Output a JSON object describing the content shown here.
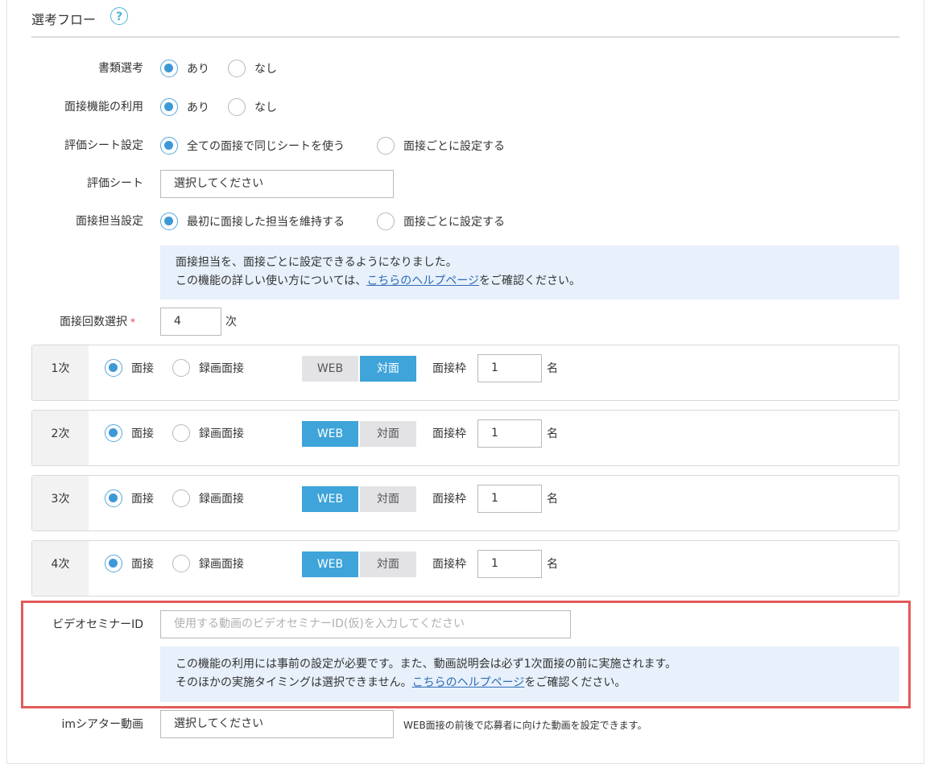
{
  "section": {
    "title": "選考フロー",
    "help": "?"
  },
  "doc_screening": {
    "label": "書類選考",
    "opt_yes": "あり",
    "opt_no": "なし",
    "selected": "yes"
  },
  "interview_function": {
    "label": "面接機能の利用",
    "opt_yes": "あり",
    "opt_no": "なし",
    "selected": "yes"
  },
  "eval_sheet_setting": {
    "label": "評価シート設定",
    "opt_same": "全ての面接で同じシートを使う",
    "opt_each": "面接ごとに設定する",
    "selected": "same"
  },
  "eval_sheet": {
    "label": "評価シート",
    "value": "選択してください"
  },
  "interviewer_setting": {
    "label": "面接担当設定",
    "opt_keep": "最初に面接した担当を維持する",
    "opt_each": "面接ごとに設定する",
    "selected": "keep"
  },
  "notice1": {
    "line1": "面接担当を、面接ごとに設定できるようになりました。",
    "line2_pre": "この機能の詳しい使い方については、",
    "line2_link": "こちらのヘルプページ",
    "line2_post": "をご確認ください。"
  },
  "round_count": {
    "label": "面接回数選択",
    "required_mark": "*",
    "value": "4",
    "unit": "次"
  },
  "stages": [
    {
      "name": "1次",
      "opt_interview": "面接",
      "opt_recorded": "録画面接",
      "web_label": "WEB",
      "face_label": "対面",
      "mode": "face",
      "slot_label": "面接枠",
      "slot_value": "1",
      "slot_unit": "名"
    },
    {
      "name": "2次",
      "opt_interview": "面接",
      "opt_recorded": "録画面接",
      "web_label": "WEB",
      "face_label": "対面",
      "mode": "web",
      "slot_label": "面接枠",
      "slot_value": "1",
      "slot_unit": "名"
    },
    {
      "name": "3次",
      "opt_interview": "面接",
      "opt_recorded": "録画面接",
      "web_label": "WEB",
      "face_label": "対面",
      "mode": "web",
      "slot_label": "面接枠",
      "slot_value": "1",
      "slot_unit": "名"
    },
    {
      "name": "4次",
      "opt_interview": "面接",
      "opt_recorded": "録画面接",
      "web_label": "WEB",
      "face_label": "対面",
      "mode": "web",
      "slot_label": "面接枠",
      "slot_value": "1",
      "slot_unit": "名"
    }
  ],
  "video_seminar": {
    "label": "ビデオセミナーID",
    "placeholder": "使用する動画のビデオセミナーID(仮)を入力してください",
    "notice_line1": "この機能の利用には事前の設定が必要です。また、動画説明会は必ず1次面接の前に実施されます。",
    "notice_line2_pre": "そのほかの実施タイミングは選択できません。",
    "notice_line2_link": "こちらのヘルプページ",
    "notice_line2_post": "をご確認ください。"
  },
  "im_theater": {
    "label": "imシアター動画",
    "value": "選択してください",
    "hint": "WEB面接の前後で応募者に向けた動画を設定できます。"
  },
  "colors": {
    "accent": "#3ea4d9",
    "radio": "#3c99d8",
    "highlight": "#e35a5a",
    "notice_bg": "#e7f0fb",
    "link": "#2f6cb5",
    "required": "#e8414d"
  }
}
